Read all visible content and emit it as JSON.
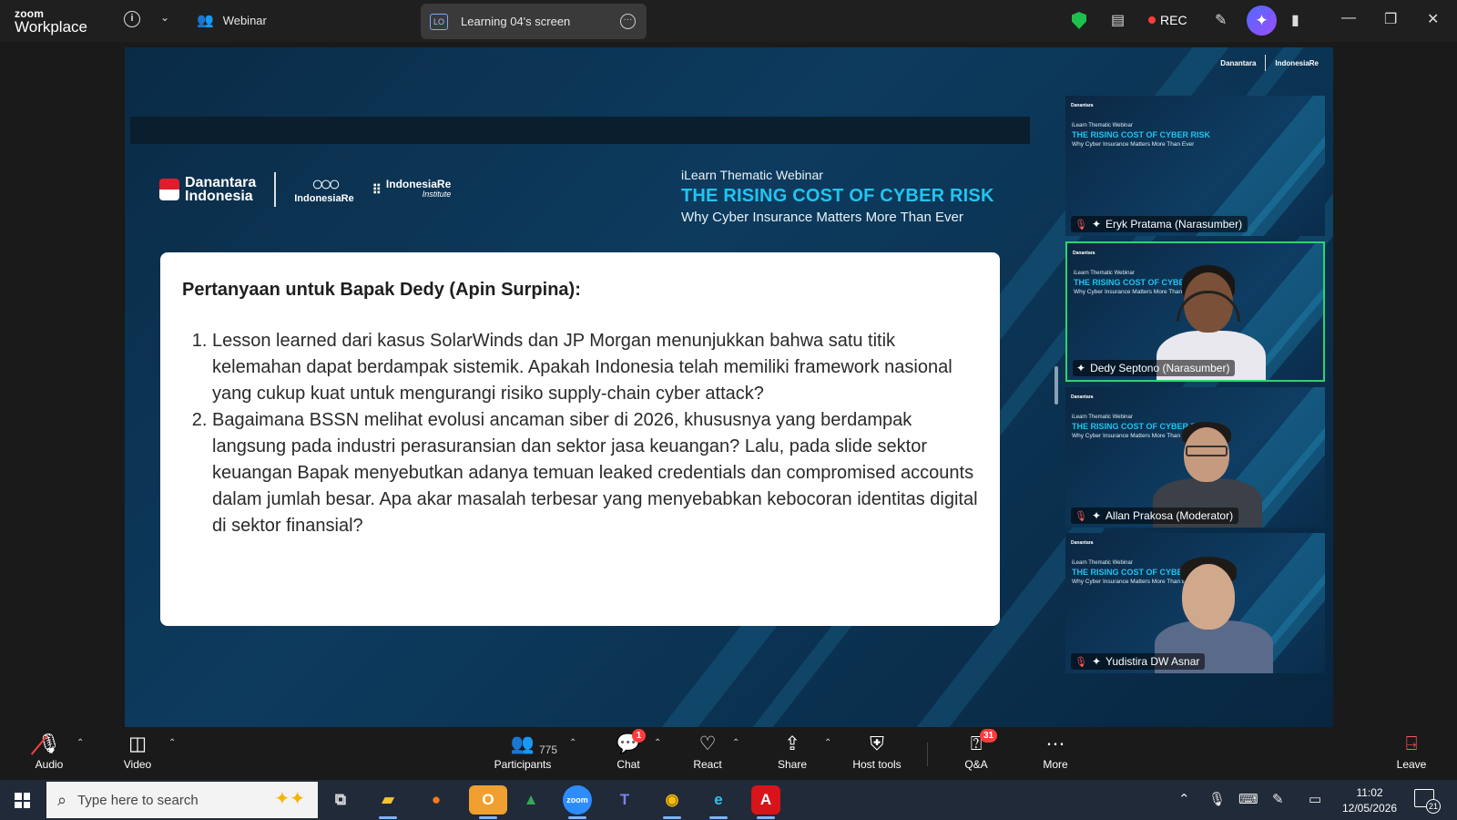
{
  "app": {
    "logo_top": "zoom",
    "logo_bottom": "Workplace"
  },
  "topbar": {
    "mode_label": "Webinar",
    "screen_badge": "LO",
    "screen_label": "Learning 04's screen",
    "rec_label": "REC"
  },
  "slide": {
    "brand_name_1": "Danantara",
    "brand_name_2": "Indonesia",
    "brand_ire": "IndonesiaRe",
    "brand_iri": "IndonesiaRe",
    "brand_iri_sub": "Institute",
    "kicker": "iLearn Thematic Webinar",
    "title": "THE RISING COST OF CYBER RISK",
    "subtitle": "Why Cyber Insurance Matters More Than Ever",
    "question_heading": "Pertanyaan untuk Bapak Dedy (Apin Surpina):",
    "questions": [
      "Lesson learned dari kasus SolarWinds dan JP Morgan menunjukkan bahwa satu titik kelemahan dapat berdampak sistemik. Apakah Indonesia telah memiliki framework nasional yang cukup kuat untuk mengurangi risiko supply-chain cyber attack?",
      "Bagaimana BSSN melihat evolusi ancaman siber di 2026, khususnya yang berdampak langsung pada industri perasuransian dan sektor jasa keuangan? Lalu, pada slide sektor keuangan Bapak menyebutkan adanya temuan leaked credentials dan compromised accounts dalam jumlah besar. Apa akar masalah terbesar yang menyebabkan kebocoran identitas digital di sektor finansial?"
    ]
  },
  "tiles": [
    {
      "name": "Eryk Pratama (Narasumber)"
    },
    {
      "name": "Dedy Septono (Narasumber)"
    },
    {
      "name": "Allan Prakosa (Moderator)"
    },
    {
      "name": "Yudistira DW Asnar"
    }
  ],
  "toolbar": {
    "audio": "Audio",
    "video": "Video",
    "participants": "Participants",
    "participants_count": "775",
    "chat": "Chat",
    "chat_badge": "1",
    "react": "React",
    "share": "Share",
    "host_tools": "Host tools",
    "qa": "Q&A",
    "qa_badge": "31",
    "more": "More",
    "leave": "Leave"
  },
  "taskbar": {
    "search_placeholder": "Type here to search",
    "time": "11:02",
    "date": "12/05/2026",
    "notif_count": "21"
  },
  "colors": {
    "accent_title": "#22c4f0",
    "active_speaker": "#2fd36a",
    "rec": "#ff3b3b"
  }
}
